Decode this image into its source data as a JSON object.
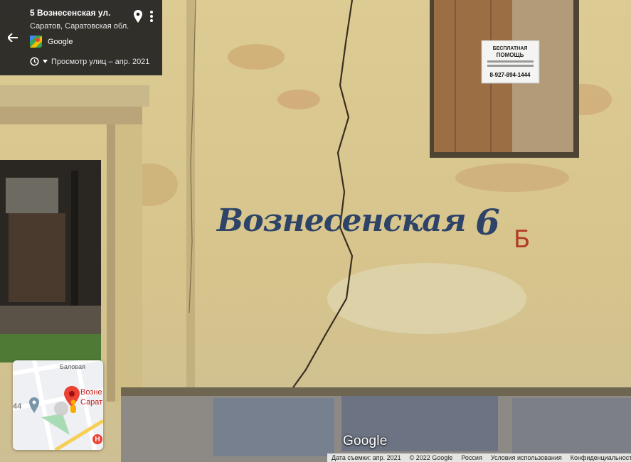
{
  "place": {
    "title": "5 Вознесенская ул.",
    "subtitle": "Саратов, Саратовская обл.",
    "provider": "Google",
    "imagery_date": "Просмотр улиц – апр. 2021"
  },
  "scene": {
    "wall_text": "Вознесенская",
    "wall_number": "6",
    "wall_letter": "Б",
    "sign_title": "БЕСПЛАТНАЯ ПОМОЩЬ",
    "sign_phone": "8-927-894-1444"
  },
  "minimap": {
    "street_label": "Баловая",
    "number_label": "44",
    "place_label_line1": "Возне",
    "place_label_line2": "Сарат",
    "badge": "H"
  },
  "watermark": "Google",
  "footer": {
    "capture_date": "Дата съемки: апр. 2021",
    "copyright": "© 2022 Google",
    "country": "Россия",
    "terms": "Условия использования",
    "privacy": "Конфиденциальность"
  },
  "icons": {
    "back": "arrow-left-icon",
    "pin": "location-pin-icon",
    "menu": "more-vert-icon",
    "clock": "clock-icon",
    "maps": "google-maps-logo"
  }
}
